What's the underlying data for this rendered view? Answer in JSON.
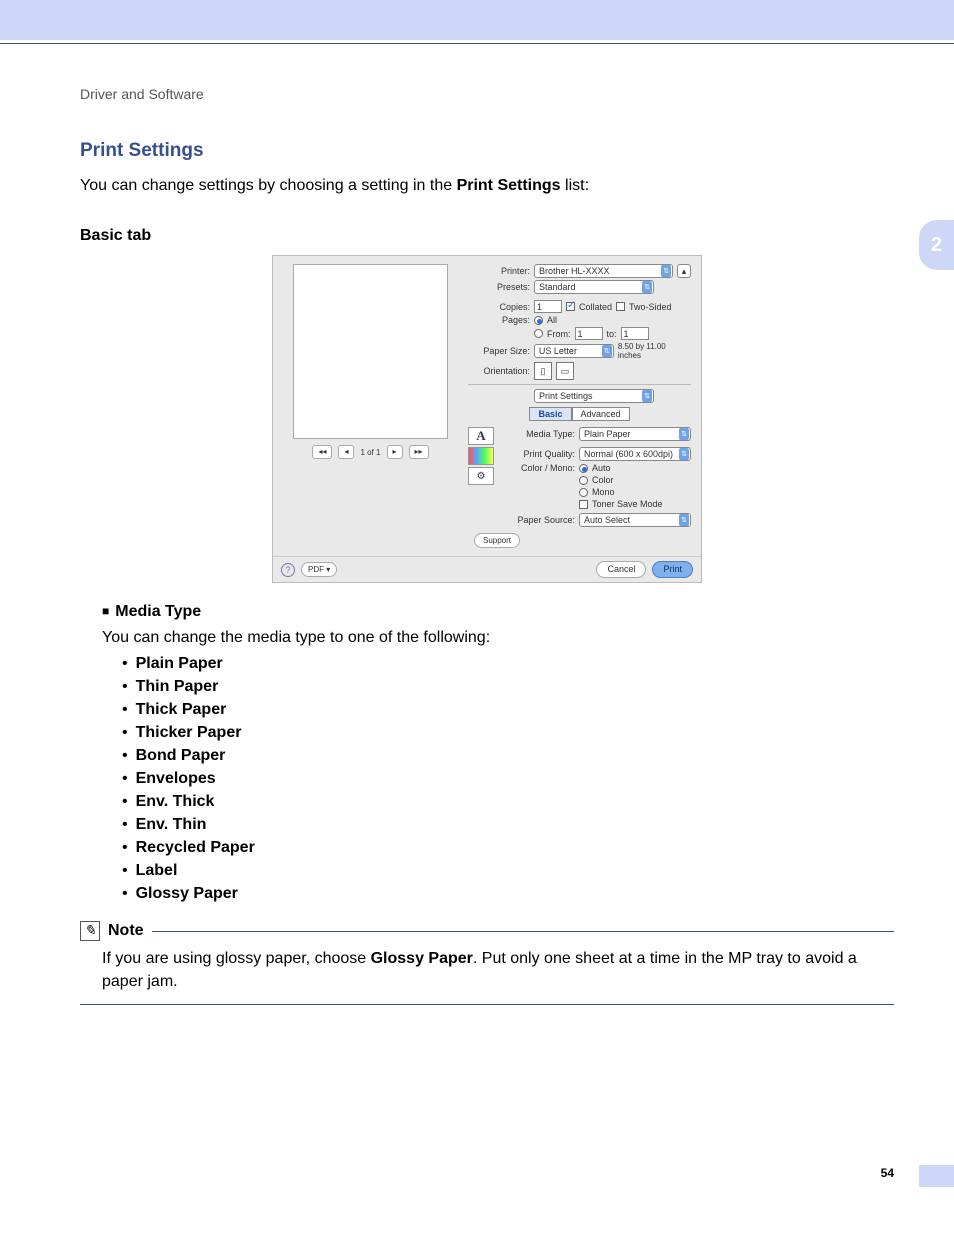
{
  "breadcrumb": "Driver and Software",
  "side_tab": "2",
  "section_title": "Print Settings",
  "intro_1": "You can change settings by choosing a setting in the ",
  "intro_bold": "Print Settings",
  "intro_2": " list:",
  "basic_tab_heading": "Basic tab",
  "dialog": {
    "printer_label": "Printer:",
    "printer_value": "Brother HL-XXXX",
    "presets_label": "Presets:",
    "presets_value": "Standard",
    "copies_label": "Copies:",
    "copies_value": "1",
    "collated": "Collated",
    "two_sided": "Two-Sided",
    "pages_label": "Pages:",
    "pages_all": "All",
    "pages_from": "From:",
    "pages_from_value": "1",
    "pages_to": "to:",
    "pages_to_value": "1",
    "paper_size_label": "Paper Size:",
    "paper_size_value": "US Letter",
    "paper_dims": "8.50 by 11.00 inches",
    "orientation_label": "Orientation:",
    "section_dropdown": "Print Settings",
    "tab_basic": "Basic",
    "tab_advanced": "Advanced",
    "media_type_label": "Media Type:",
    "media_type_value": "Plain Paper",
    "print_quality_label": "Print Quality:",
    "print_quality_value": "Normal (600 x 600dpi)",
    "color_mono_label": "Color / Mono:",
    "color_mono_auto": "Auto",
    "color_mono_color": "Color",
    "color_mono_mono": "Mono",
    "toner_save": "Toner Save Mode",
    "paper_source_label": "Paper Source:",
    "paper_source_value": "Auto Select",
    "preview_page": "1 of 1",
    "support_btn": "Support",
    "pdf_btn": "PDF ▾",
    "cancel_btn": "Cancel",
    "print_btn": "Print"
  },
  "media_type_heading": "Media Type",
  "media_type_desc": "You can change the media type to one of the following:",
  "media_types": [
    "Plain Paper",
    "Thin Paper",
    "Thick Paper",
    "Thicker Paper",
    "Bond Paper",
    "Envelopes",
    "Env. Thick",
    "Env. Thin",
    "Recycled Paper",
    "Label",
    "Glossy Paper"
  ],
  "note_label": "Note",
  "note_1": "If you are using glossy paper, choose ",
  "note_bold": "Glossy Paper",
  "note_2": ". Put only one sheet at a time in the MP tray to avoid a paper jam.",
  "page_number": "54"
}
